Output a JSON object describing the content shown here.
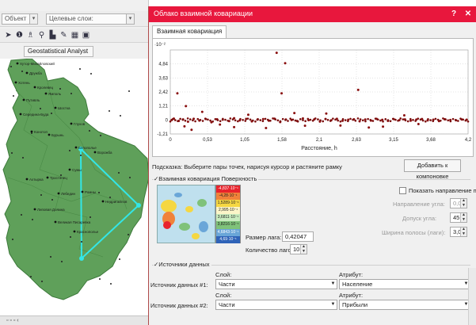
{
  "arcmap": {
    "toolbar": {
      "layer_combo": "Объект",
      "target_combo": "Целевые слои:",
      "geostat_button": "Geostatistical Analyst"
    },
    "map": {
      "cities": [
        "Хутор-Михайловский",
        "Дружба",
        "Хотень",
        "Кролевец",
        "Путивль",
        "Ямполь",
        "Шостка",
        "Глухов",
        "Середина-Буда",
        "Конотоп",
        "Бурынь",
        "Белополье",
        "Ворожба",
        "Сумы",
        "Тростянец",
        "Ахтырка",
        "Лебедин",
        "Ромны",
        "Недригайлов",
        "Липовая Долина",
        "Великая Писаревка",
        "Краснополье"
      ]
    },
    "status_bar": {
      "text": "▫ ▫ ▫ ‹"
    }
  },
  "dialog": {
    "title": "Облако взаимной ковариации",
    "help_label": "?",
    "close_label": "✕",
    "tab_label": "Взаимная ковариация",
    "hint": "Подсказка: Выберите пары точек, нарисуя курсор и растяните рамку",
    "add_button": "Добавить к компоновке",
    "surface_group": "Взаимная ковариация Поверхность",
    "legend_values": [
      "-4,837·10⁻¹",
      "-4,28·10⁻¹",
      "1,5289·10⁻¹",
      "2,995·10⁻¹",
      "3,6811·10⁻¹",
      "3,8216·10⁻¹",
      "4,6843·10⁻¹",
      "4,69·10⁻¹"
    ],
    "lag_size_label": "Размер лага:",
    "lag_size_value": "0,42047",
    "lag_count_label": "Количество лагов:",
    "lag_count_value": "10",
    "show_direction_label": "Показать направление поиска",
    "direction_label": "Направление угла:",
    "direction_value": "0,0",
    "tolerance_label": "Допуск угла:",
    "tolerance_value": "45,0",
    "bandwidth_label": "Ширина полосы (лаги):",
    "bandwidth_value": "3,0",
    "sources_group": "Источники данных",
    "layer_header": "Слой:",
    "attribute_header": "Атрибут:",
    "source1_label": "Источник данных #1:",
    "source1_layer": "Части",
    "source1_attribute": "Население",
    "source2_label": "Источник данных #2:",
    "source2_layer": "Части",
    "source2_attribute": "Прибыли"
  },
  "chart_data": {
    "type": "scatter",
    "title": "",
    "xlabel": "Расстояние, h",
    "ylabel": "",
    "y_exponent_label": "·10⁻²",
    "xlim": [
      0,
      4.2
    ],
    "ylim": [
      -1.21,
      6.05
    ],
    "x_ticks": [
      "0",
      "0,53",
      "1,05",
      "1,58",
      "2,1",
      "2,63",
      "3,15",
      "3,68",
      "4,2"
    ],
    "y_ticks": [
      "-1,21",
      "0",
      "1,21",
      "2,42",
      "3,63",
      "4,84"
    ],
    "grid": true,
    "series": [
      {
        "values_x": [
          0.02,
          0.05,
          0.12,
          0.18,
          0.25,
          0.33,
          0.41,
          0.5,
          0.58,
          0.66,
          0.74,
          0.83,
          0.9,
          0.98,
          1.07,
          1.15,
          1.23,
          1.31,
          1.39,
          1.47,
          1.55,
          1.63,
          1.71,
          1.79,
          1.87,
          1.95,
          2.03,
          2.11,
          2.19,
          2.27,
          2.35,
          2.43,
          2.51,
          2.59,
          2.67,
          2.75,
          2.83,
          2.91,
          2.99,
          3.07,
          3.15,
          3.23,
          3.31,
          3.39,
          3.47,
          3.55,
          3.63,
          3.71,
          3.79,
          3.87,
          3.95,
          4.03,
          4.11,
          4.18,
          0.1,
          0.22,
          1.5,
          1.62,
          1.57,
          2.65,
          0.2,
          0.9,
          1.35,
          2.4,
          3.0,
          0.7,
          1.9,
          3.5,
          0.45,
          2.2,
          1.1,
          3.3,
          0.3,
          2.8,
          1.75
        ],
        "values_y": [
          0.0,
          0.12,
          -0.08,
          0.05,
          -0.15,
          0.1,
          -0.05,
          0.08,
          -0.2,
          0.06,
          0.02,
          -0.1,
          0.15,
          -0.04,
          0.09,
          -0.12,
          0.03,
          0.07,
          -0.06,
          0.11,
          -0.18,
          0.04,
          0.0,
          -0.09,
          0.13,
          -0.02,
          0.05,
          -0.14,
          0.08,
          -0.03,
          0.1,
          -0.07,
          0.02,
          0.06,
          -0.11,
          0.04,
          -0.05,
          0.09,
          0.01,
          -0.08,
          0.07,
          -0.02,
          0.05,
          -0.06,
          0.03,
          0.08,
          -0.04,
          0.02,
          -0.1,
          0.06,
          0.0,
          -0.03,
          0.04,
          0.02,
          2.3,
          1.2,
          5.8,
          4.9,
          2.3,
          2.6,
          -0.55,
          -0.62,
          -0.7,
          -0.48,
          -0.58,
          -0.4,
          -0.5,
          -0.35,
          0.7,
          0.55,
          0.45,
          0.4,
          -0.85,
          -0.65,
          0.6
        ]
      }
    ]
  }
}
